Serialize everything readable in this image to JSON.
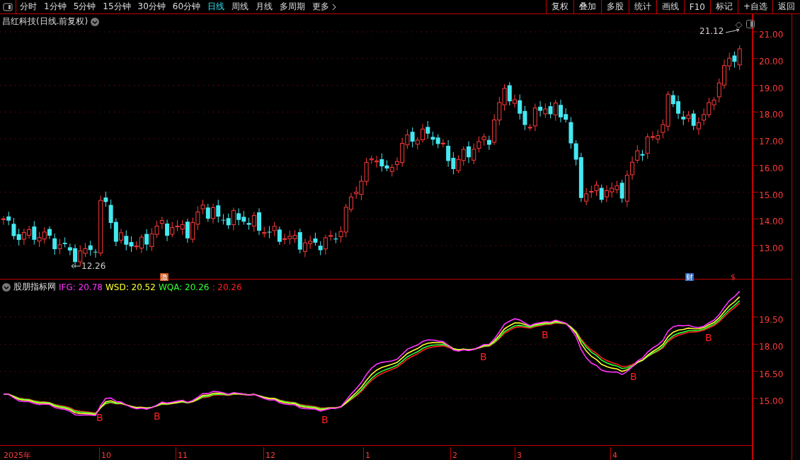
{
  "toolbar": {
    "periods": [
      {
        "label": "分时",
        "selected": false
      },
      {
        "label": "1分钟",
        "selected": false
      },
      {
        "label": "5分钟",
        "selected": false
      },
      {
        "label": "15分钟",
        "selected": false
      },
      {
        "label": "30分钟",
        "selected": false
      },
      {
        "label": "60分钟",
        "selected": false
      },
      {
        "label": "日线",
        "selected": true
      },
      {
        "label": "周线",
        "selected": false
      },
      {
        "label": "月线",
        "selected": false
      },
      {
        "label": "多周期",
        "selected": false
      },
      {
        "label": "更多",
        "selected": false
      }
    ],
    "actions": [
      "复权",
      "叠加",
      "多股",
      "统计",
      "画线",
      "F10",
      "标记",
      "+自选",
      "返回"
    ]
  },
  "chart": {
    "title": "昌红科技(日线.前复权)",
    "high_label": "21.12",
    "low_label": "12.26",
    "price_ticks": [
      "21.00",
      "20.00",
      "19.00",
      "18.00",
      "17.00",
      "16.00",
      "15.00",
      "14.00",
      "13.00"
    ],
    "event_badges": [
      {
        "label": "激",
        "kind": "box",
        "color": "#c8561e"
      },
      {
        "label": "财",
        "kind": "box",
        "color": "#2f66c0"
      },
      {
        "label": "$",
        "kind": "glyph",
        "color": "#ff3030"
      }
    ]
  },
  "indicator": {
    "name": "股朋指标网",
    "legend": [
      {
        "label": "IFG: 20.78",
        "color": "#ff33ff"
      },
      {
        "label": "WSD: 20.52",
        "color": "#ffff33"
      },
      {
        "label": "WQA: 20.26",
        "color": "#33ff33"
      },
      {
        "label": ": 20.26",
        "color": "#ff2020"
      }
    ],
    "ticks": [
      "19.50",
      "18.00",
      "16.50",
      "15.00"
    ],
    "signals": [
      "B",
      "B",
      "B",
      "B",
      "B",
      "B",
      "B"
    ]
  },
  "date_axis": [
    "2025年",
    "10",
    "11",
    "12",
    "1",
    "2",
    "3",
    "4"
  ]
}
